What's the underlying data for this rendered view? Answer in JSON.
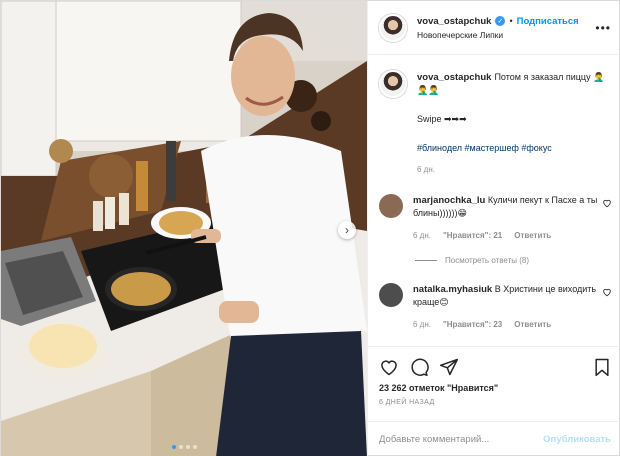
{
  "header": {
    "username": "vova_ostapchuk",
    "follow_label": "Подписаться",
    "location": "Новопечерские Липки",
    "separator": "•"
  },
  "caption": {
    "username": "vova_ostapchuk",
    "text": "Потом я заказал пиццу 🤦‍♂️🤦‍♂️🤦‍♂️",
    "swipe": "Swipe ➡➡➡",
    "hashtags": "#блинодел #мастершеф #фокус",
    "age": "6 дн."
  },
  "comments": [
    {
      "username": "marjanochka_lu",
      "text": "Куличи пекут к Пасхе а ты блины))))))😁",
      "age": "6 дн.",
      "likes": "\"Нравится\": 21",
      "reply_label": "Ответить",
      "view_replies": "Посмотреть ответы (8)",
      "avatar_color": "#8a6a55"
    },
    {
      "username": "natalka.myhasiuk",
      "text": "В Христини це виходить краще😊",
      "age": "6 дн.",
      "likes": "\"Нравится\": 23",
      "reply_label": "Ответить",
      "avatar_color": "#4d4d4d"
    }
  ],
  "actions": {
    "likes": "23 262 отметок \"Нравится\"",
    "posted_ago": "6 ДНЕЙ НАЗАД"
  },
  "comment_input": {
    "placeholder": "Добавьте комментарий...",
    "publish_label": "Опубликовать"
  },
  "carousel": {
    "count": 4,
    "active_index": 0
  },
  "colors": {
    "accent": "#0095f6",
    "verified": "#3897f0",
    "hashtag": "#00376b",
    "muted": "#8e8e8e"
  }
}
